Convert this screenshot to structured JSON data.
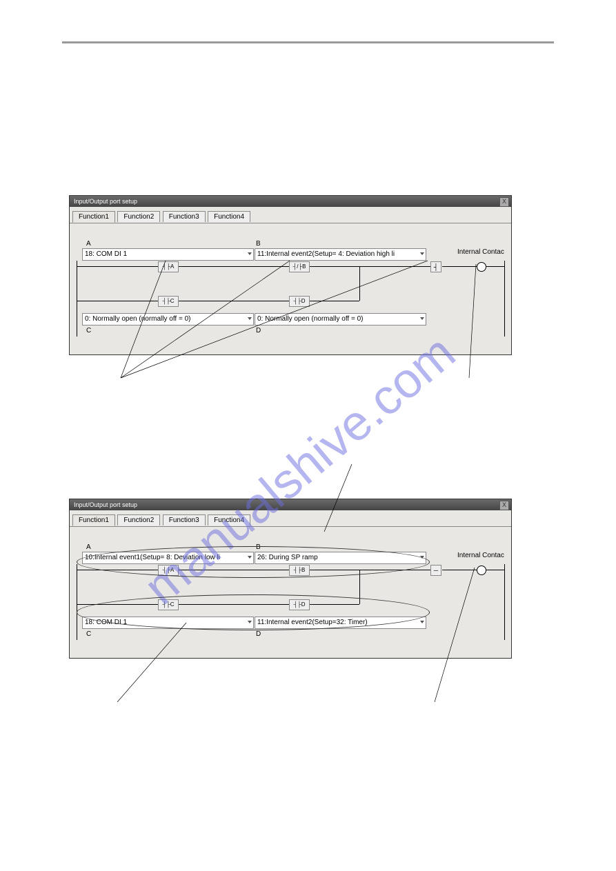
{
  "screenshot1": {
    "title": "Input/Output port setup",
    "tabs": [
      "Function1",
      "Function2",
      "Function3",
      "Function4"
    ],
    "active_tab": 0,
    "label_a": "A",
    "label_b": "B",
    "label_c": "C",
    "label_d": "D",
    "dropdown_a": "18: COM DI 1",
    "dropdown_b": "11:Internal event2(Setup= 4: Deviation high li",
    "dropdown_c": "0: Normally open (normally off = 0)",
    "dropdown_d": "0: Normally open (normally off = 0)",
    "contact_a": "┤├A",
    "contact_b": "┤/├B",
    "contact_c": "┤├C",
    "contact_d": "┤├D",
    "internal_contact": "Internal Contac",
    "out_symbol": "┤",
    "close_label": "X"
  },
  "screenshot2": {
    "title": "Input/Output port setup",
    "tabs": [
      "Function1",
      "Function2",
      "Function3",
      "Function4"
    ],
    "active_tab": 0,
    "label_a": "A",
    "label_b": "B",
    "label_c": "C",
    "label_d": "D",
    "dropdown_a": "10:Internal event1(Setup= 8: Deviation low li",
    "dropdown_b": "26: During SP ramp",
    "dropdown_c": "18: COM DI 1",
    "dropdown_d": "11:Internal event2(Setup=32: Timer)",
    "contact_a": "┤├A",
    "contact_b": "┤├B",
    "contact_c": "┤├C",
    "contact_d": "┤├D",
    "internal_contact": "Internal Contac",
    "out_symbol": "─",
    "close_label": "X"
  },
  "watermark": "manualshive.com"
}
